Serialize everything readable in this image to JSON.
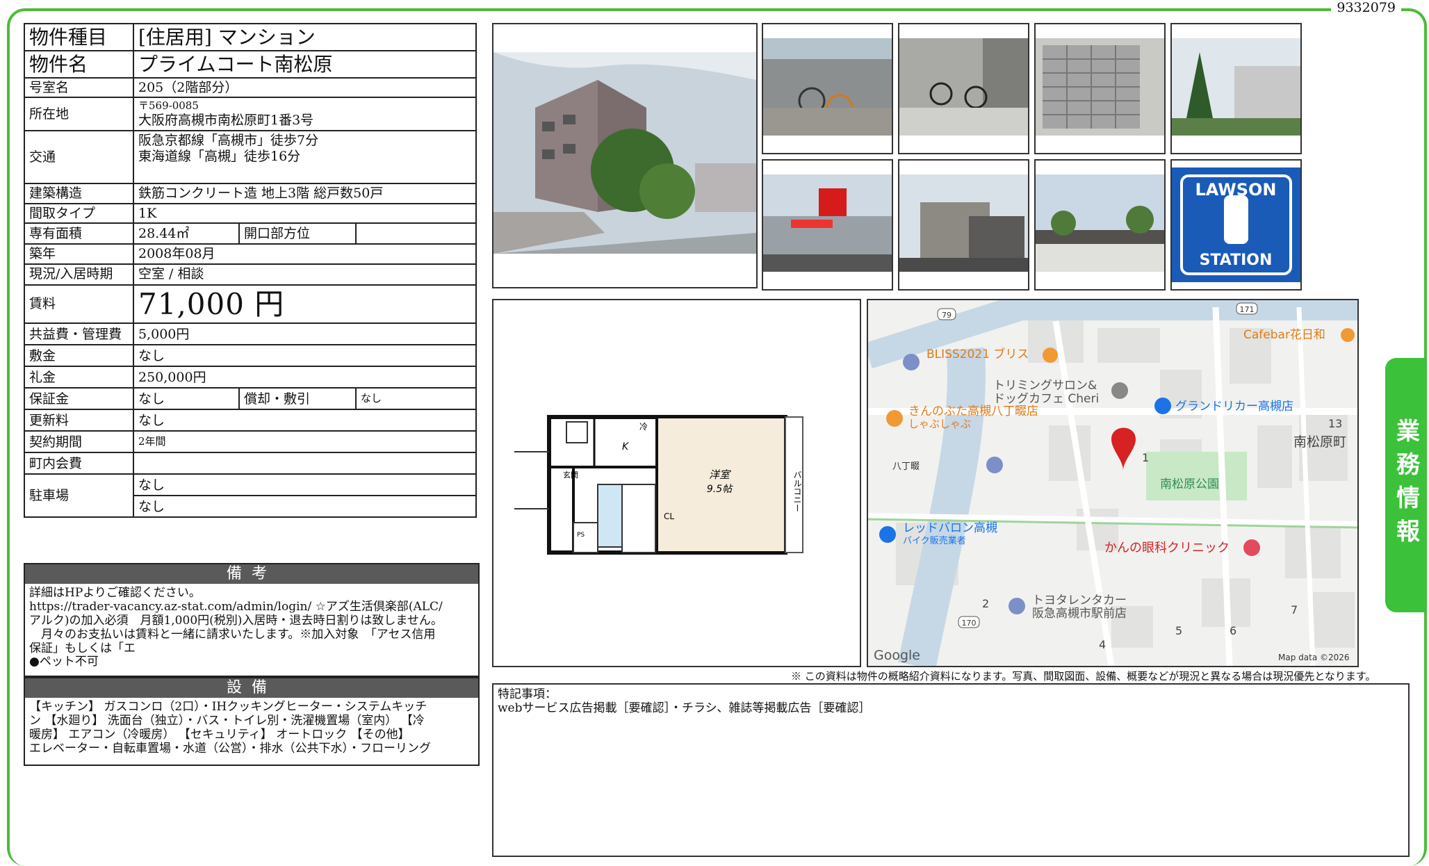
{
  "doc_id": "9332079",
  "side_tab": "業務情報",
  "spec": {
    "type_label": "物件種目",
    "type_value": "[住居用] マンション",
    "name_label": "物件名",
    "name_value": "プライムコート南松原",
    "room_label": "号室名",
    "room_value": "205（2階部分）",
    "addr_label": "所在地",
    "addr_zip": "〒569-0085",
    "addr_value": "大阪府高槻市南松原町1番3号",
    "access_label": "交通",
    "access_line1": "阪急京都線「高槻市」徒歩7分",
    "access_line2": "東海道線「高槻」徒歩16分",
    "struct_label": "建築構造",
    "struct_value": "鉄筋コンクリート造 地上3階 総戸数50戸",
    "layout_label": "間取タイプ",
    "layout_value": "1K",
    "area_label": "専有面積",
    "area_value": "28.44㎡",
    "dir_label": "開口部方位",
    "dir_value": "",
    "built_label": "築年",
    "built_value": "2008年08月",
    "status_label": "現況/入居時期",
    "status_value": "空室 / 相談",
    "rent_label": "賃料",
    "rent_value": "71,000 円",
    "fee_label": "共益費・管理費",
    "fee_value": "5,000円",
    "deposit_label": "敷金",
    "deposit_value": "なし",
    "keymoney_label": "礼金",
    "keymoney_value": "250,000円",
    "guarantee_label": "保証金",
    "guarantee_value": "なし",
    "amort_label": "償却・敷引",
    "amort_value": "なし",
    "renew_label": "更新料",
    "renew_value": "なし",
    "contract_label": "契約期間",
    "contract_value": "2年間",
    "town_label": "町内会費",
    "town_value": "",
    "parking_label": "駐車場",
    "parking_value1": "なし",
    "parking_value2": "なし"
  },
  "remarks_section": {
    "title": "備考",
    "body": "詳細はHPよりご確認ください。\nhttps://trader-vacancy.az-stat.com/admin/login/ ☆アズ生活倶楽部(ALC/\nアルク)の加入必須　月額1,000円(税別)入居時・退去時日割りは致しません。\n　月々のお支払いは賃料と一緒に請求いたします。※加入対象　「アセス信用\n保証」もしくは「エ\n●ペット不可"
  },
  "equipment_section": {
    "title": "設備",
    "body": "【キッチン】 ガスコンロ（2口）・IHクッキングヒーター・システムキッチ\nン 【水廻り】 洗面台（独立）・バス・トイレ別・洗濯機置場（室内） 【冷\n暖房】 エアコン（冷暖房） 【セキュリティ】 オートロック 【その他】\nエレベーター・自転車置場・水道（公営）・排水（公共下水）・フローリング"
  },
  "floorplan": {
    "western_room": "洋室",
    "western_size": "9.5帖",
    "kitchen": "K",
    "entrance": "玄関",
    "closet": "CL",
    "balcony": "バルコニー",
    "fridge": "冷",
    "ps": "PS"
  },
  "map": {
    "labels": {
      "bliss": "BLISS2021 ブリス",
      "trim1": "トリミングサロン&",
      "trim2": "ドッグカフェ Cheri",
      "grand": "グランドリカー高槻店",
      "kinobuta1": "きんのぶた高槻八丁畷店",
      "kinobuta2": "しゃぶしゃぶ",
      "cafebar": "Cafebar花日和",
      "hatchonawate": "八丁畷",
      "park": "南松原公園",
      "town": "南松原町",
      "red1": "レッドバロン高槻",
      "red2": "バイク販売業者",
      "clinic": "かんの眼科クリニック",
      "toyota1": "トヨタレンタカー",
      "toyota2": "阪急高槻市駅前店",
      "google": "Google",
      "mapdata": "Map data ©2026",
      "r79": "79",
      "r171": "171",
      "r170": "170",
      "n1": "1",
      "n2": "2",
      "n4": "4",
      "n5": "5",
      "n6": "6",
      "n7": "7",
      "n13": "13"
    }
  },
  "notice": "※ この資料は物件の概略紹介資料になります。写真、間取図面、設備、概要などが現況と異なる場合は現況優先となります。",
  "special": {
    "title": "特記事項：",
    "body": "webサービス広告掲載［要確認］・チラシ、雑誌等掲載広告［要確認］"
  }
}
